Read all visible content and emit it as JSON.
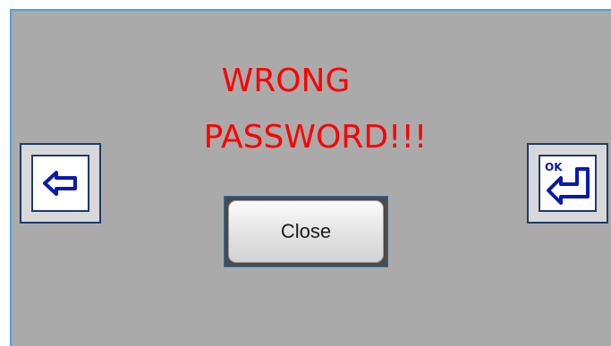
{
  "dialog": {
    "message_line_1": "WRONG",
    "message_line_2": "PASSWORD!!!",
    "message_color": "#ff0000",
    "background_color": "#aaaaaa"
  },
  "buttons": {
    "close_label": "Close",
    "back_icon": "back-arrow-icon",
    "ok_icon": "ok-enter-icon",
    "ok_icon_text": "OK"
  }
}
